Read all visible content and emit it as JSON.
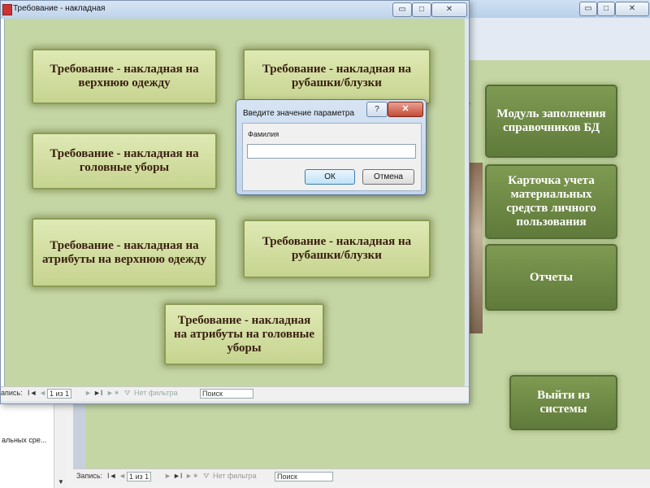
{
  "background_window": {
    "nav_item": "альных сре...",
    "italic_fragment": "в",
    "buttons": {
      "module_fill": "Модуль заполнения справочников БД",
      "card": "Карточка учета материальных средств личного пользования",
      "reports": "Отчеты",
      "exit": "Выйти из системы"
    },
    "recordbar": {
      "label": "Запись:",
      "position": "1 из 1",
      "filter": "Нет фильтра",
      "search": "Поиск"
    },
    "controls": {
      "minimize": "▭",
      "maximize": "□",
      "close": "✕"
    }
  },
  "form_window": {
    "title": "Требование - накладная",
    "controls": {
      "minimize": "▭",
      "maximize": "□",
      "close": "✕"
    },
    "buttons": [
      "Требование - накладная на верхнюю одежду",
      "Требование - накладная на рубашки/блузки",
      "Требование - накладная на головные уборы",
      "Требование - накладная на атрибуты на верхнюю одежду",
      "Требование - накладная на рубашки/блузки",
      "Требование - накладная на атрибуты на головные уборы"
    ],
    "recordbar": {
      "label": "апись:",
      "position": "1 из 1",
      "filter": "Нет фильтра",
      "search": "Поиск"
    }
  },
  "dialog": {
    "title": "Введите значение параметра",
    "help": "?",
    "close": "✕",
    "field_label": "Фамилия",
    "field_value": "",
    "ok": "ОК",
    "cancel": "Отмена"
  }
}
